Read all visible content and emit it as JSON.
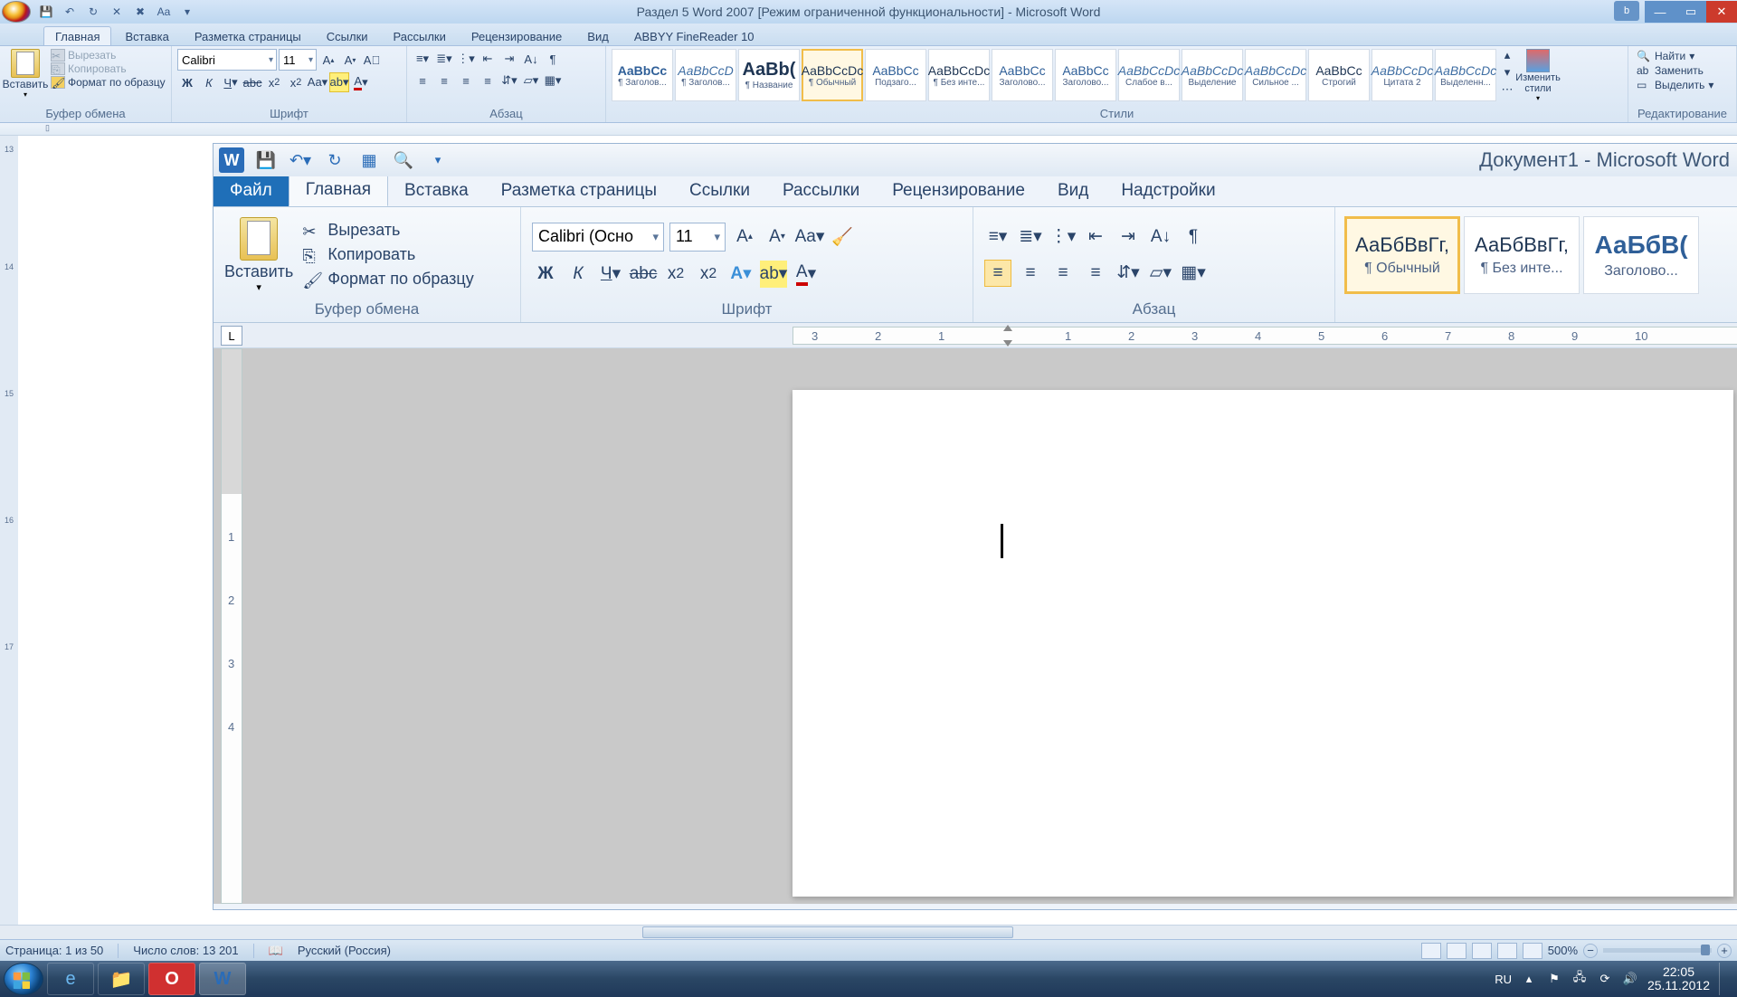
{
  "outer": {
    "title": "Раздел 5 Word 2007 [Режим ограниченной функциональности] - Microsoft Word",
    "qat": [
      "save",
      "undo",
      "redo",
      "close",
      "x",
      "font"
    ],
    "tabs": [
      "Главная",
      "Вставка",
      "Разметка страницы",
      "Ссылки",
      "Рассылки",
      "Рецензирование",
      "Вид",
      "ABBYY FineReader 10"
    ],
    "active_tab": 0,
    "clipboard": {
      "paste": "Вставить",
      "cut": "Вырезать",
      "copy": "Копировать",
      "format": "Формат по образцу",
      "group": "Буфер обмена"
    },
    "font": {
      "name": "Calibri",
      "size": "11",
      "group": "Шрифт"
    },
    "paragraph": {
      "group": "Абзац"
    },
    "styles": {
      "group": "Стили",
      "change": "Изменить стили",
      "items": [
        {
          "prev": "AaBbCc",
          "lbl": "¶ Заголов...",
          "v": "head"
        },
        {
          "prev": "AaBbCcD",
          "lbl": "¶ Заголов...",
          "v": "ital"
        },
        {
          "prev": "AaBb(",
          "lbl": "¶ Название",
          "v": "big"
        },
        {
          "prev": "AaBbCcDc",
          "lbl": "¶ Обычный",
          "v": "sel"
        },
        {
          "prev": "AaBbCc",
          "lbl": "Подзаго...",
          "v": "blue"
        },
        {
          "prev": "AaBbCcDc",
          "lbl": "¶ Без инте...",
          "v": ""
        },
        {
          "prev": "AaBbCc",
          "lbl": "Заголово...",
          "v": "blue"
        },
        {
          "prev": "AaBbCc",
          "lbl": "Заголово...",
          "v": "blue"
        },
        {
          "prev": "AaBbCcDc",
          "lbl": "Слабое в...",
          "v": "ital"
        },
        {
          "prev": "AaBbCcDc",
          "lbl": "Выделение",
          "v": "ital"
        },
        {
          "prev": "AaBbCcDc",
          "lbl": "Сильное ...",
          "v": "ital"
        },
        {
          "prev": "AaBbCc",
          "lbl": "Строгий",
          "v": ""
        },
        {
          "prev": "AaBbCcDc",
          "lbl": "Цитата 2",
          "v": "ital"
        },
        {
          "prev": "AaBbCcDc",
          "lbl": "Выделенн...",
          "v": "ital"
        }
      ]
    },
    "editing": {
      "group": "Редактирование",
      "find": "Найти",
      "replace": "Заменить",
      "select": "Выделить"
    }
  },
  "inner": {
    "doc_title": "Документ1 - Microsoft Word",
    "tabs": [
      "Файл",
      "Главная",
      "Вставка",
      "Разметка страницы",
      "Ссылки",
      "Рассылки",
      "Рецензирование",
      "Вид",
      "Надстройки"
    ],
    "active_tab": 1,
    "clipboard": {
      "paste": "Вставить",
      "cut": "Вырезать",
      "copy": "Копировать",
      "format": "Формат по образцу",
      "group": "Буфер обмена"
    },
    "font": {
      "name": "Calibri (Осно",
      "size": "11",
      "group": "Шрифт"
    },
    "paragraph": {
      "group": "Абзац"
    },
    "styles": {
      "items": [
        {
          "prev": "АаБбВвГг,",
          "lbl": "¶ Обычный",
          "sel": true
        },
        {
          "prev": "АаБбВвГг,",
          "lbl": "¶ Без инте...",
          "sel": false
        },
        {
          "prev": "АаБбВ(",
          "lbl": "Заголово...",
          "sel": false,
          "blue": true
        }
      ]
    },
    "ruler_marks": [
      "3",
      "2",
      "1",
      "1",
      "2",
      "3",
      "4",
      "5",
      "6",
      "7",
      "8",
      "9",
      "10"
    ],
    "vruler": [
      "1",
      "2",
      "3",
      "4"
    ]
  },
  "status": {
    "page": "Страница: 1 из 50",
    "words": "Число слов: 13 201",
    "lang": "Русский (Россия)",
    "zoom": "500%"
  },
  "taskbar": {
    "lang": "RU",
    "time": "22:05",
    "date": "25.11.2012"
  }
}
